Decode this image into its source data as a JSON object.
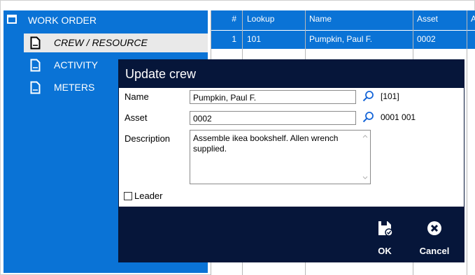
{
  "sidebar": {
    "title": "WORK ORDER",
    "items": [
      {
        "label": "CREW / RESOURCE",
        "selected": true,
        "icon": "document-icon"
      },
      {
        "label": "ACTIVITY",
        "selected": false,
        "icon": "document-icon"
      },
      {
        "label": "METERS",
        "selected": false,
        "icon": "document-icon"
      }
    ]
  },
  "grid": {
    "columns": [
      "#",
      "Lookup",
      "Name",
      "Asset",
      "A"
    ],
    "rows": [
      {
        "num": "1",
        "lookup": "101",
        "name": "Pumpkin, Paul F.",
        "asset": "0002"
      }
    ]
  },
  "dialog": {
    "title": "Update crew",
    "name_label": "Name",
    "name_value": "Pumpkin, Paul F.",
    "name_code": "[101]",
    "asset_label": "Asset",
    "asset_value": "0002",
    "asset_code": "0001 001",
    "description_label": "Description",
    "description_value": "Assemble ikea bookshelf.  Allen wrench supplied.",
    "leader_label": "Leader",
    "leader_checked": false,
    "ok_label": "OK",
    "cancel_label": "Cancel"
  },
  "colors": {
    "sidebar_bg": "#0a73d6",
    "dialog_dark": "#06163a",
    "search_icon": "#1565d8"
  }
}
